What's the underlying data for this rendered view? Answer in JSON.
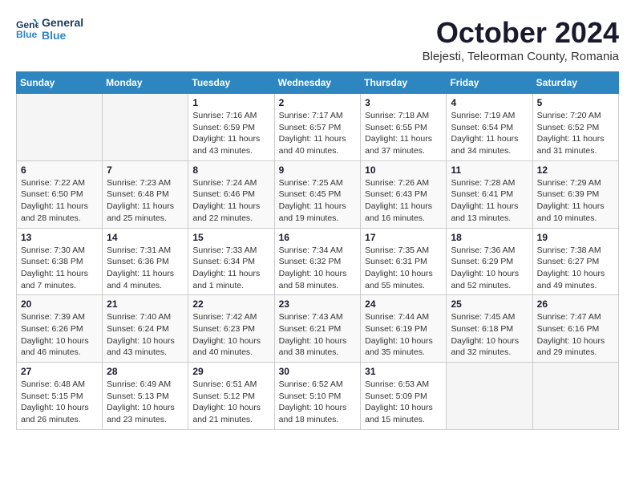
{
  "logo": {
    "line1": "General",
    "line2": "Blue"
  },
  "title": "October 2024",
  "subtitle": "Blejesti, Teleorman County, Romania",
  "headers": [
    "Sunday",
    "Monday",
    "Tuesday",
    "Wednesday",
    "Thursday",
    "Friday",
    "Saturday"
  ],
  "weeks": [
    [
      {
        "num": "",
        "info": ""
      },
      {
        "num": "",
        "info": ""
      },
      {
        "num": "1",
        "info": "Sunrise: 7:16 AM\nSunset: 6:59 PM\nDaylight: 11 hours and 43 minutes."
      },
      {
        "num": "2",
        "info": "Sunrise: 7:17 AM\nSunset: 6:57 PM\nDaylight: 11 hours and 40 minutes."
      },
      {
        "num": "3",
        "info": "Sunrise: 7:18 AM\nSunset: 6:55 PM\nDaylight: 11 hours and 37 minutes."
      },
      {
        "num": "4",
        "info": "Sunrise: 7:19 AM\nSunset: 6:54 PM\nDaylight: 11 hours and 34 minutes."
      },
      {
        "num": "5",
        "info": "Sunrise: 7:20 AM\nSunset: 6:52 PM\nDaylight: 11 hours and 31 minutes."
      }
    ],
    [
      {
        "num": "6",
        "info": "Sunrise: 7:22 AM\nSunset: 6:50 PM\nDaylight: 11 hours and 28 minutes."
      },
      {
        "num": "7",
        "info": "Sunrise: 7:23 AM\nSunset: 6:48 PM\nDaylight: 11 hours and 25 minutes."
      },
      {
        "num": "8",
        "info": "Sunrise: 7:24 AM\nSunset: 6:46 PM\nDaylight: 11 hours and 22 minutes."
      },
      {
        "num": "9",
        "info": "Sunrise: 7:25 AM\nSunset: 6:45 PM\nDaylight: 11 hours and 19 minutes."
      },
      {
        "num": "10",
        "info": "Sunrise: 7:26 AM\nSunset: 6:43 PM\nDaylight: 11 hours and 16 minutes."
      },
      {
        "num": "11",
        "info": "Sunrise: 7:28 AM\nSunset: 6:41 PM\nDaylight: 11 hours and 13 minutes."
      },
      {
        "num": "12",
        "info": "Sunrise: 7:29 AM\nSunset: 6:39 PM\nDaylight: 11 hours and 10 minutes."
      }
    ],
    [
      {
        "num": "13",
        "info": "Sunrise: 7:30 AM\nSunset: 6:38 PM\nDaylight: 11 hours and 7 minutes."
      },
      {
        "num": "14",
        "info": "Sunrise: 7:31 AM\nSunset: 6:36 PM\nDaylight: 11 hours and 4 minutes."
      },
      {
        "num": "15",
        "info": "Sunrise: 7:33 AM\nSunset: 6:34 PM\nDaylight: 11 hours and 1 minute."
      },
      {
        "num": "16",
        "info": "Sunrise: 7:34 AM\nSunset: 6:32 PM\nDaylight: 10 hours and 58 minutes."
      },
      {
        "num": "17",
        "info": "Sunrise: 7:35 AM\nSunset: 6:31 PM\nDaylight: 10 hours and 55 minutes."
      },
      {
        "num": "18",
        "info": "Sunrise: 7:36 AM\nSunset: 6:29 PM\nDaylight: 10 hours and 52 minutes."
      },
      {
        "num": "19",
        "info": "Sunrise: 7:38 AM\nSunset: 6:27 PM\nDaylight: 10 hours and 49 minutes."
      }
    ],
    [
      {
        "num": "20",
        "info": "Sunrise: 7:39 AM\nSunset: 6:26 PM\nDaylight: 10 hours and 46 minutes."
      },
      {
        "num": "21",
        "info": "Sunrise: 7:40 AM\nSunset: 6:24 PM\nDaylight: 10 hours and 43 minutes."
      },
      {
        "num": "22",
        "info": "Sunrise: 7:42 AM\nSunset: 6:23 PM\nDaylight: 10 hours and 40 minutes."
      },
      {
        "num": "23",
        "info": "Sunrise: 7:43 AM\nSunset: 6:21 PM\nDaylight: 10 hours and 38 minutes."
      },
      {
        "num": "24",
        "info": "Sunrise: 7:44 AM\nSunset: 6:19 PM\nDaylight: 10 hours and 35 minutes."
      },
      {
        "num": "25",
        "info": "Sunrise: 7:45 AM\nSunset: 6:18 PM\nDaylight: 10 hours and 32 minutes."
      },
      {
        "num": "26",
        "info": "Sunrise: 7:47 AM\nSunset: 6:16 PM\nDaylight: 10 hours and 29 minutes."
      }
    ],
    [
      {
        "num": "27",
        "info": "Sunrise: 6:48 AM\nSunset: 5:15 PM\nDaylight: 10 hours and 26 minutes."
      },
      {
        "num": "28",
        "info": "Sunrise: 6:49 AM\nSunset: 5:13 PM\nDaylight: 10 hours and 23 minutes."
      },
      {
        "num": "29",
        "info": "Sunrise: 6:51 AM\nSunset: 5:12 PM\nDaylight: 10 hours and 21 minutes."
      },
      {
        "num": "30",
        "info": "Sunrise: 6:52 AM\nSunset: 5:10 PM\nDaylight: 10 hours and 18 minutes."
      },
      {
        "num": "31",
        "info": "Sunrise: 6:53 AM\nSunset: 5:09 PM\nDaylight: 10 hours and 15 minutes."
      },
      {
        "num": "",
        "info": ""
      },
      {
        "num": "",
        "info": ""
      }
    ]
  ]
}
